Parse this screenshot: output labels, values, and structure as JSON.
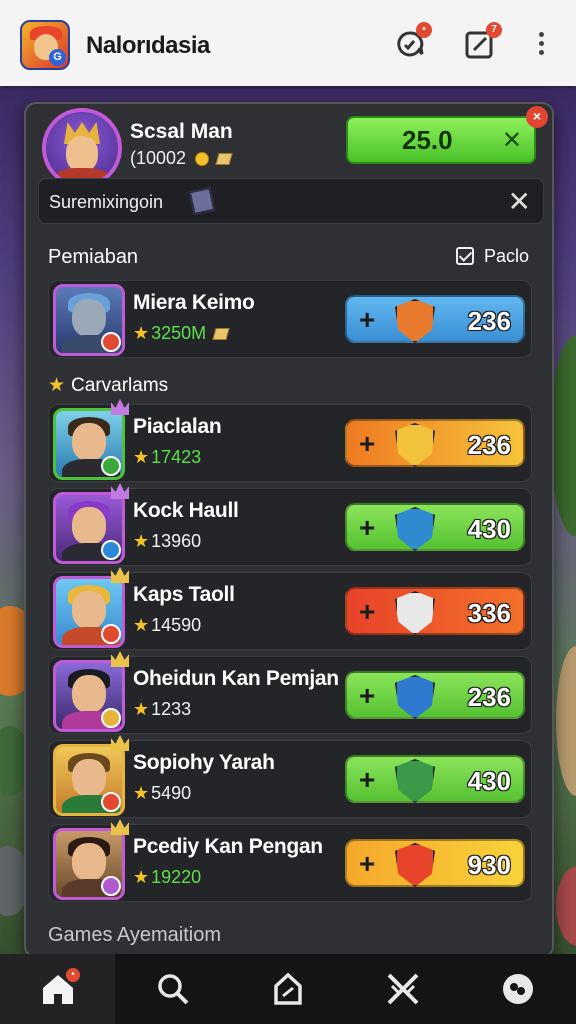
{
  "app": {
    "title": "Nalorıdasia",
    "notif_badge": "•",
    "edit_badge": "7"
  },
  "profile": {
    "name": "Scsal Man",
    "coins": "(10002",
    "balance": "25.0",
    "balance_close": "✕",
    "close_badge": "×"
  },
  "notice": {
    "text": "Suremixingoin",
    "close": "✕"
  },
  "section": {
    "title": "Pemiaban",
    "link": "Paclo",
    "subtitle": "Carvarlams"
  },
  "featured": {
    "name": "Miera Keimo",
    "score": "3250M",
    "value": "236"
  },
  "rows": [
    {
      "name": "Piaclalan",
      "score": "17423",
      "value": "236"
    },
    {
      "name": "Kock Haull",
      "score": "13960",
      "value": "430"
    },
    {
      "name": "Kaps Taoll",
      "score": "14590",
      "value": "336"
    },
    {
      "name": "Oheidun Kan Pemjan",
      "score": "1233",
      "value": "236"
    },
    {
      "name": "Sopiohy Yarah",
      "score": "5490",
      "value": "430"
    },
    {
      "name": "Pcediy Kan Pengan",
      "score": "19220",
      "value": "930"
    }
  ],
  "footer": {
    "text": "Games Ayemaitiom"
  },
  "colors": {
    "blue": "#4aa4e6",
    "orange": "#f3a22a",
    "green": "#6fd644",
    "red": "#ee5a2a",
    "yellow": "#f5c230",
    "accent_purple": "#c259d6"
  },
  "nav": [
    {
      "icon": "home-icon",
      "active": true,
      "badge": "•"
    },
    {
      "icon": "search-icon"
    },
    {
      "icon": "shop-icon"
    },
    {
      "icon": "battle-icon"
    },
    {
      "icon": "profile-icon"
    }
  ]
}
